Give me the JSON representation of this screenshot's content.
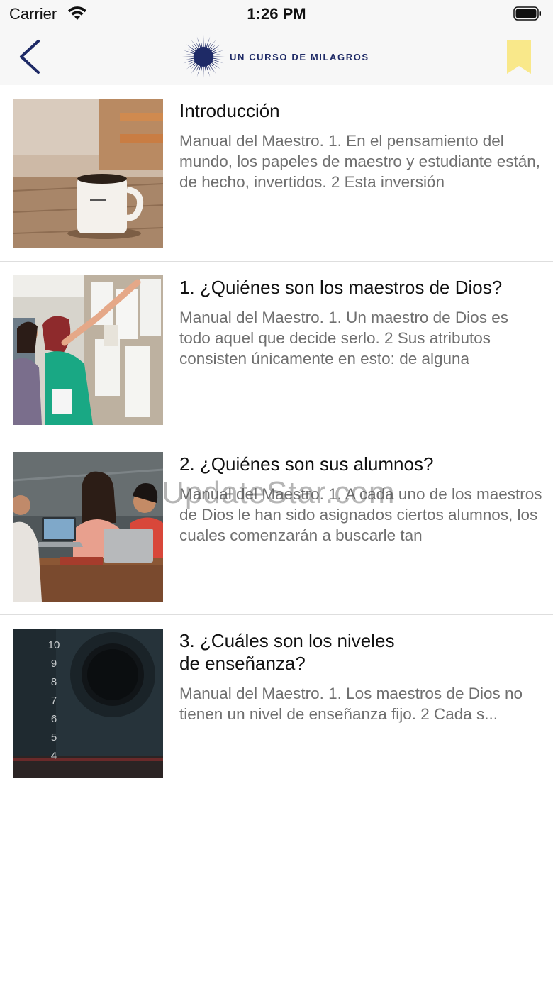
{
  "status_bar": {
    "carrier": "Carrier",
    "time": "1:26 PM"
  },
  "nav": {
    "logo_text": "UN CURSO DE MILAGROS",
    "bookmark_color": "#f9e88a",
    "accent_color": "#1e2a66"
  },
  "items": [
    {
      "title": "Introducción",
      "description": "Manual del Maestro. 1. En el pensamiento del mundo, los papeles de maestro y estudiante están, de hecho, invertidos. 2 Esta inversión",
      "image": "coffee-mug-on-wooden-table"
    },
    {
      "title": "1. ¿Quiénes son los maestros de Dios?",
      "description": "Manual del Maestro. 1. Un maestro de Dios es todo aquel que decide serlo. 2 Sus atributos consisten únicamente en esto: de alguna",
      "image": "woman-pointing-at-papers-on-wall"
    },
    {
      "title": "2. ¿Quiénes son sus alumnos?",
      "description": "Manual del Maestro. 1. A cada uno de los maestros de Dios le han sido asignados ciertos alumnos, los cuales comenzarán a buscarle tan",
      "image": "group-of-people-with-laptops"
    },
    {
      "title_lines": [
        "3. ¿Cuáles son los niveles",
        "de enseñanza?"
      ],
      "description": "Manual del Maestro. 1. Los maestros de Dios no tienen un nivel de enseñanza fijo. 2 Cada s...",
      "image": "dark-rotary-dial-with-numbers",
      "dial_numbers": [
        "10",
        "9",
        "8",
        "7",
        "6",
        "5",
        "4"
      ]
    }
  ],
  "watermark": "UpdateStar.com"
}
